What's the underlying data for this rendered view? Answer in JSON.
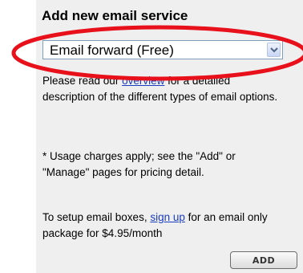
{
  "section": {
    "title": "Add new email service"
  },
  "service_select": {
    "selected": "Email forward (Free)"
  },
  "info": {
    "p1_before_link": "Please read our ",
    "p1_link": "overview",
    "p1_after_link": " for a detailed description of the different types of email options.",
    "p2": "* Usage charges apply; see the \"Add\" or \"Manage\" pages for pricing detail.",
    "p3_before_link": "To setup email boxes, ",
    "p3_link": "sign up",
    "p3_after_link": " for an email only package for $4.95/month"
  },
  "actions": {
    "add_label": "ADD"
  },
  "colors": {
    "panel_bg": "#efefef",
    "link": "#1a3dc1",
    "highlight": "#e8101a"
  },
  "icons": {
    "dropdown": "chevron-down-icon"
  }
}
